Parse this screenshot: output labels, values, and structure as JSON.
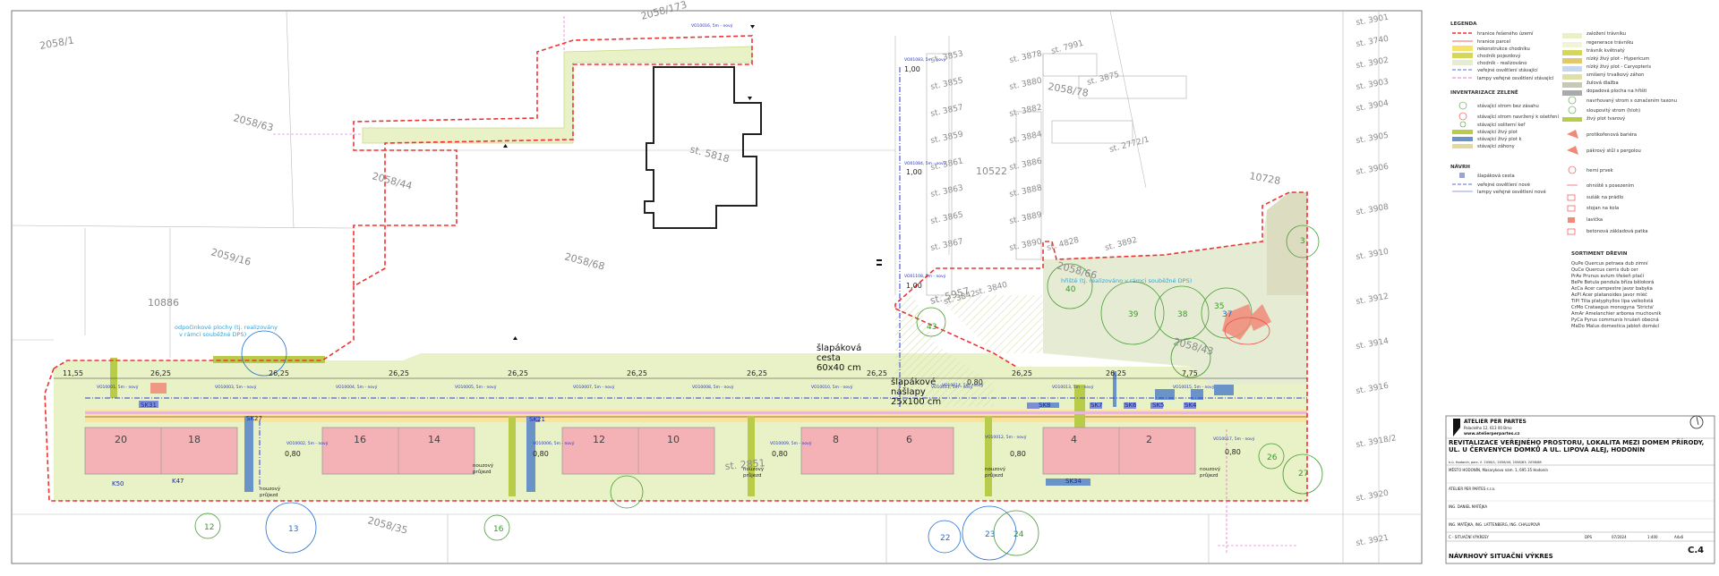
{
  "plan": {
    "parcels": [
      "2058/1",
      "2058/63",
      "2058/44",
      "2059/16",
      "2058/68",
      "10886",
      "2058/173",
      "2058/78",
      "10522",
      "10728",
      "2058/43",
      "2058/66",
      "st. 2851",
      "2058/35",
      "st. 5818",
      "st. 5957"
    ],
    "building": "",
    "houses": [
      "20",
      "18",
      "16",
      "14",
      "12",
      "10",
      "8",
      "6",
      "4",
      "2"
    ],
    "dims": [
      "11,55",
      "26,25",
      "26,25",
      "26,25",
      "26,25",
      "26,25",
      "26,25",
      "26,25",
      "26,25",
      "26,25",
      "7,75",
      "1,00",
      "1,00",
      "1,00",
      "0,80",
      "0,80",
      "0,80",
      "0,80",
      "0,80",
      "0,80"
    ],
    "notes": {
      "paving_1": "šlapáková",
      "paving_2": "cesta",
      "paving_3": "60x40 cm",
      "steps_1": "šlapákové",
      "steps_2": "nášlapy",
      "steps_3": "25x100 cm",
      "cyan_left_1": "odpočinkové plochy (tj. realizovány",
      "cyan_left_2": "v rámci souběžné DPS)",
      "cyan_right": "hřiště (tj. realizováno v rámci souběžné DPS)"
    },
    "lamps": [
      "VO10001, 5m - nový",
      "VO10003, 5m - nový",
      "VO10004, 5m - nový",
      "VO10005, 5m - nový",
      "VO10007, 5m - nový",
      "VO10008, 5m - nový",
      "VO10010, 5m - nový",
      "VO10011, 5m - nový",
      "VO10013, 5m - nový",
      "VO10015, 5m - nový",
      "VO01083, 5m - nový",
      "VO01084, 5m - nový",
      "VO01108, 5m - nový",
      "VO10016, 5m - nový",
      "VO10006, 5m - nový",
      "VO10009, 5m - nový",
      "VO10012, 5m - nový",
      "VO10017, 5m - nový",
      "VO10002, 5m - nový",
      "VO10014, 5m - nový"
    ],
    "passages": [
      "nouzový",
      "průjezd"
    ],
    "bins": [
      "SK31",
      "SK27",
      "SK21",
      "SK8",
      "SK7",
      "SK6",
      "SK5",
      "SK4",
      "SK34",
      "K50",
      "K47"
    ],
    "trees": [
      "12",
      "13",
      "16",
      "22",
      "23",
      "24",
      "39",
      "38",
      "37",
      "40",
      "35",
      "43",
      "27",
      "3",
      "26"
    ],
    "st_right": [
      "st. 3901",
      "st. 3740",
      "st. 3902",
      "st. 3903",
      "st. 3904",
      "st. 3905",
      "st. 3906",
      "st. 3908",
      "st. 3910",
      "st. 3912",
      "st. 3914",
      "st. 3916",
      "st. 3918/2",
      "st. 3920",
      "st. 3921"
    ],
    "st_left": [
      "st. 3853",
      "st. 3855",
      "st. 3857",
      "st. 3859",
      "st. 3861",
      "st. 3863",
      "st. 3865",
      "st. 3867",
      "st. 3878",
      "st. 3880",
      "st. 3882",
      "st. 3884",
      "st. 3886",
      "st. 3888",
      "st. 3889",
      "st. 3890"
    ],
    "st_top": [
      "st. 7991",
      "st. 3875",
      "st. 2772/1",
      "st. 4828",
      "st. 3892",
      "st. 3842",
      "st. 3840"
    ]
  },
  "legend": {
    "title": "LEGENDA",
    "items": [
      "hranice řešeného území",
      "hranice parcel",
      "rekonstrukce chodníku",
      "chodník pojezdový",
      "chodník - realizováno",
      "veřejné osvětlení stávající",
      "lampy veřejné osvětlení stávající"
    ],
    "inv_title": "INVENTARIZACE ZELENĚ",
    "inv": [
      "stávající strom bez zásahu",
      "stávající strom navržený k ošetření",
      "stávající soliterní keř",
      "stávající živý plot",
      "stávající živý plot k",
      "stávající záhony"
    ],
    "navrh_title": "NÁVRH",
    "navrh": [
      "šlapáková cesta",
      "veřejné osvětlení nové",
      "lampy veřejné osvětlení nové"
    ],
    "right": [
      "založení trávníku",
      "regenerace trávníku",
      "trávník květnatý",
      "nízký živý plot - Hypericum",
      "nízký živý plot - Caryopteris",
      "smíšený trvalkový záhon",
      "žulová dlažba",
      "dopadová plocha na hřišti",
      "navrhovaný strom s označením taxonu",
      "sloupovitý strom (hloh)",
      "živý plot tvarový",
      "protikořenová bariéra",
      "pákrový stůl s pergolou",
      "herní prvek",
      "ohniště s posezením",
      "sušák na prádlo",
      "stojan na kola",
      "lavička",
      "betonová základová patka"
    ],
    "species_title": "SORTIMENT DŘEVIN",
    "species": [
      "QuPe Quercus petraea   dub zimní",
      "QuCe Quercus cerris   dub cer",
      "PrAv Prunus avium   třešeň ptačí",
      "BePe Betula pendula   bříza bělokorá",
      "AcCa Acer campestre   javor babyka",
      "AcPl Acer platanoides   javor mléč",
      "TiPl Tilia platyphyllos   lípa velkolistá",
      "CrMo Crataegus monogyna 'Stricta'",
      "AmAr Amelanchier arborea   muchovník",
      "PyCa Pyrus communis   hrušeň obecná",
      "MaDo Malus domestica   jabloň domácí"
    ]
  },
  "titleblock": {
    "firm": "ATELIER PER PARTES",
    "firm_addr": "Palackého 12, 613 00 Brno",
    "firm_web": "www.atelierperpartes.cz",
    "project_1": "REVITALIZACE VEŘEJNÉHO PROSTORU, LOKALITA MEZI DOMEM PŘÍRODY,",
    "project_2": "UL. U ČERVENÝCH DOMKŮ A UL. LIPOVÁ ALEJ, HODONÍN",
    "project_3": "",
    "addr": "k.ú. Hodonín, parc. č. 2058/1, 2058/44, 2058/63, 2058/68",
    "investor": "MĚSTO HODONÍN, Masarykovo nám. 1, 695 35 Hodonín",
    "designer": "ATELIER PER PARTES s.r.o.",
    "responsible": "ING. DANIEL MATĚJKA",
    "drawn": "ING. MATĚJKA, ING. LATTENBERG, ING. CHALUPOVÁ",
    "sheet_name": "C - SITUAČNÍ VÝKRESY",
    "stage": "DPS",
    "date": "07/2024",
    "scale": "1:400",
    "format": "A4x6",
    "number": "C.4",
    "sheet_title": "NÁVRHOVÝ SITUAČNÍ VÝKRES"
  }
}
